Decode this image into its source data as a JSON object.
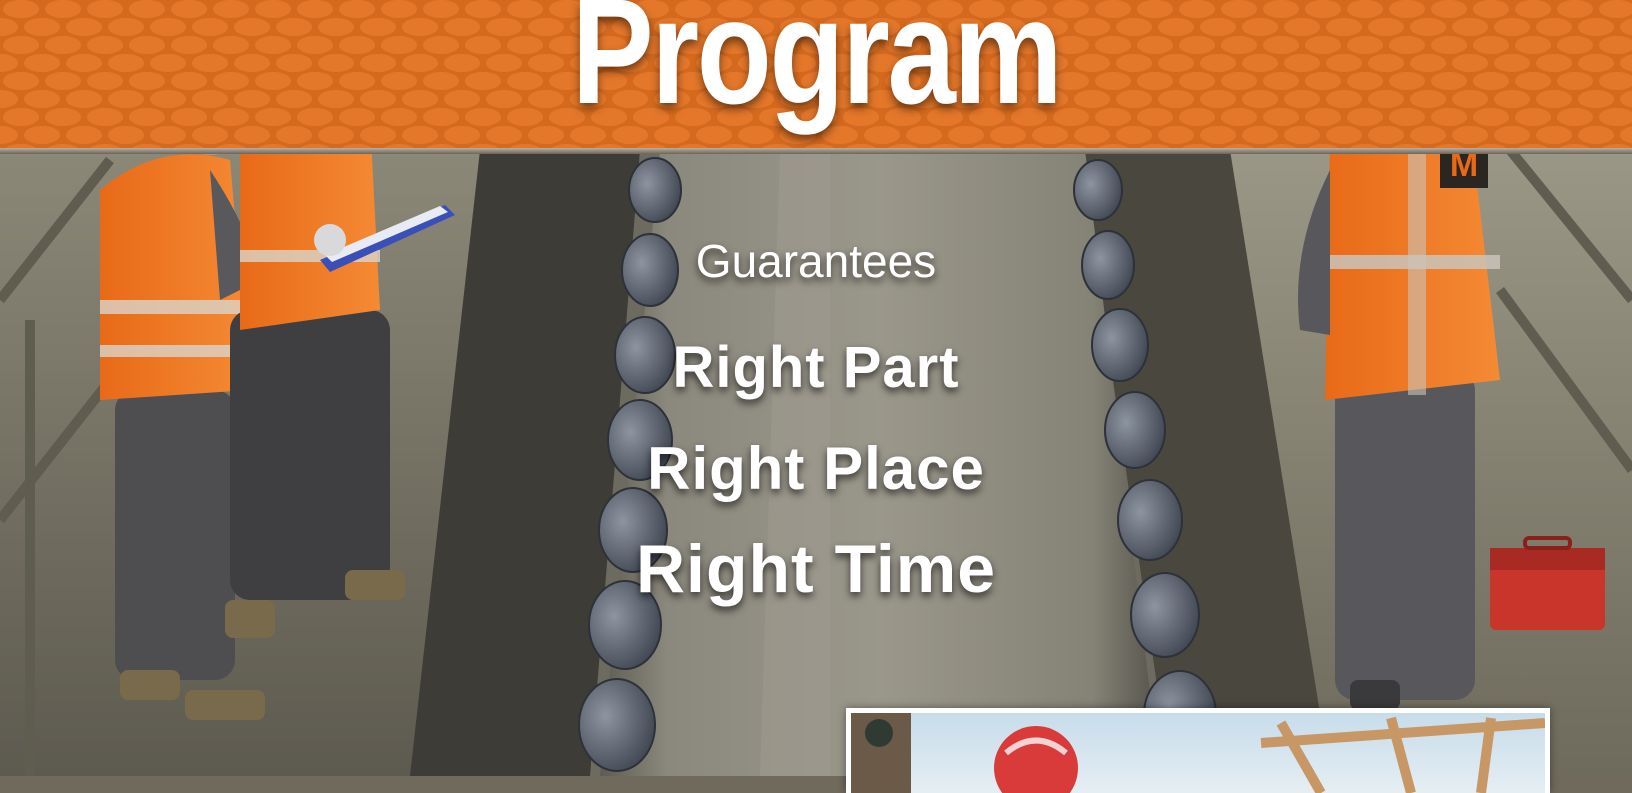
{
  "banner": {
    "title": "Program"
  },
  "headline": {
    "lead": "Guarantees",
    "lines": [
      "Right Part",
      "Right Place",
      "Right Time"
    ]
  },
  "scene": {
    "description_icons": [
      "hard-hat-icon",
      "clipboard-icon",
      "toolbox-icon",
      "conveyor-belt-icon"
    ],
    "vest_badge_text": "M"
  },
  "colors": {
    "banner_orange": "#d56a1e",
    "vest_orange": "#f0741f",
    "text": "#ffffff",
    "toolbox_red": "#c9352a",
    "belt_gray": "#7a776c"
  }
}
